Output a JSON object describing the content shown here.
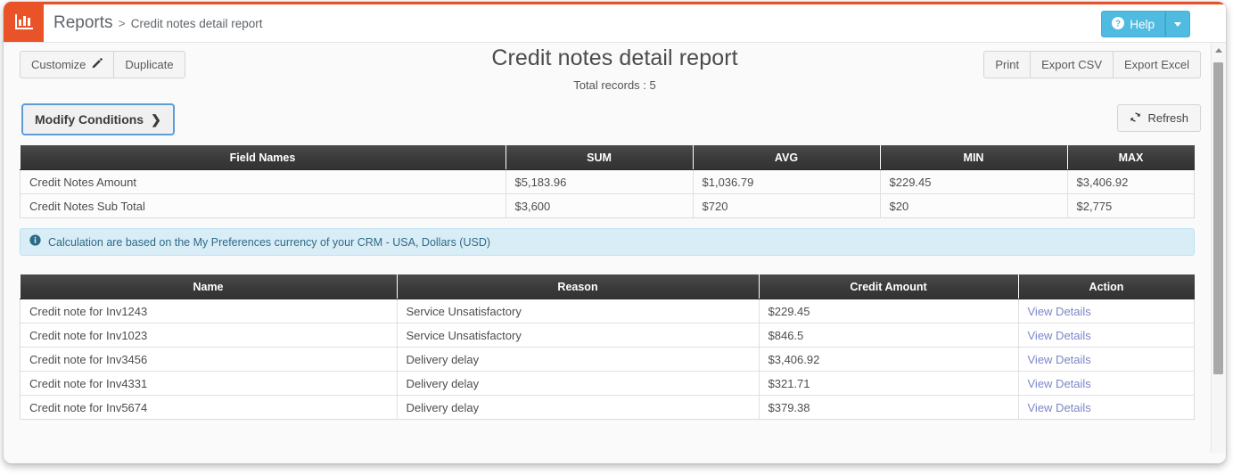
{
  "window": {
    "accent_color": "#e8502a"
  },
  "header": {
    "logo_icon": "bar-chart-icon",
    "breadcrumb_root": "Reports",
    "breadcrumb_separator": ">",
    "breadcrumb_current": "Credit notes detail report",
    "help_label": "Help",
    "help_icon": "question-circle-icon",
    "help_caret_icon": "chevron-down-icon"
  },
  "toolbar": {
    "customize_label": "Customize",
    "customize_icon": "pencil-icon",
    "duplicate_label": "Duplicate",
    "print_label": "Print",
    "export_csv_label": "Export CSV",
    "export_excel_label": "Export Excel"
  },
  "title": {
    "report_title": "Credit notes detail report",
    "total_records": "Total records : 5"
  },
  "conditions": {
    "modify_label": "Modify Conditions",
    "modify_icon": "chevron-right-icon",
    "refresh_label": "Refresh",
    "refresh_icon": "refresh-icon"
  },
  "summary_table": {
    "columns": [
      "Field Names",
      "SUM",
      "AVG",
      "MIN",
      "MAX"
    ],
    "rows": [
      {
        "field": "Credit Notes Amount",
        "sum": "$5,183.96",
        "avg": "$1,036.79",
        "min": "$229.45",
        "max": "$3,406.92"
      },
      {
        "field": "Credit Notes Sub Total",
        "sum": "$3,600",
        "avg": "$720",
        "min": "$20",
        "max": "$2,775"
      }
    ]
  },
  "alert": {
    "icon": "info-circle-icon",
    "text": "Calculation are based on the My Preferences currency of your CRM - USA, Dollars (USD)",
    "background_color": "#d9edf7"
  },
  "detail_table": {
    "columns": [
      "Name",
      "Reason",
      "Credit Amount",
      "Action"
    ],
    "rows": [
      {
        "name": "Credit note for Inv1243",
        "reason": "Service Unsatisfactory",
        "amount": "$229.45",
        "action": "View Details"
      },
      {
        "name": "Credit note for Inv1023",
        "reason": "Service Unsatisfactory",
        "amount": "$846.5",
        "action": "View Details"
      },
      {
        "name": "Credit note for Inv3456",
        "reason": "Delivery delay",
        "amount": "$3,406.92",
        "action": "View Details"
      },
      {
        "name": "Credit note for Inv4331",
        "reason": "Delivery delay",
        "amount": "$321.71",
        "action": "View Details"
      },
      {
        "name": "Credit note for Inv5674",
        "reason": "Delivery delay",
        "amount": "$379.38",
        "action": "View Details"
      }
    ]
  },
  "scrollbar": {
    "up_arrow_icon": "triangle-up-icon"
  }
}
